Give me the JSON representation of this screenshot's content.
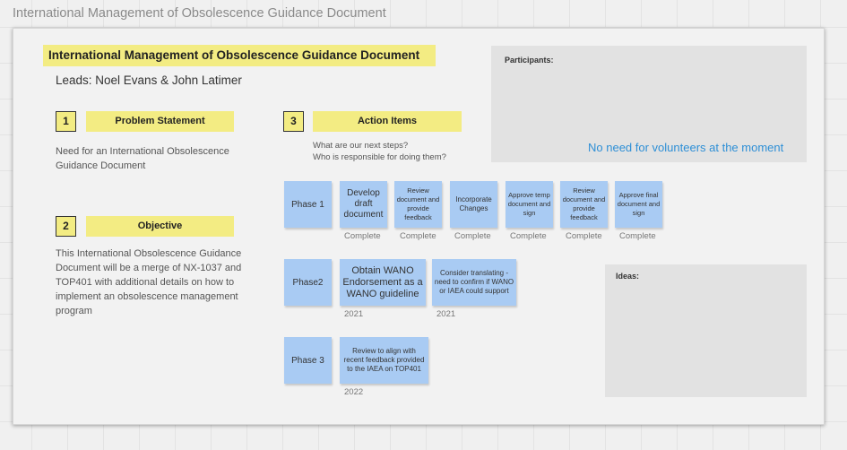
{
  "page": {
    "heading": "International Management of Obsolescence Guidance Document"
  },
  "doc": {
    "title": "International Management of Obsolescence Guidance Document",
    "leads": "Leads: Noel Evans & John Latimer"
  },
  "sections": {
    "problem": {
      "number": "1",
      "label": "Problem Statement",
      "text": "Need for an International Obsolescence Guidance Document"
    },
    "objective": {
      "number": "2",
      "label": "Objective",
      "text": "This International Obsolescence Guidance Document will be a merge of NX-1037 and TOP401 with additional details on how to implement an obsolescence management program"
    },
    "actions": {
      "number": "3",
      "label": "Action Items",
      "prompt_line1": "What are our next steps?",
      "prompt_line2": "Who is responsible for doing them?"
    }
  },
  "participants": {
    "title": "Participants:",
    "note": "No need for volunteers at the moment"
  },
  "ideas": {
    "title": "Ideas:"
  },
  "phase1": {
    "label": "Phase 1",
    "items": [
      {
        "text": "Develop draft document",
        "status": "Complete"
      },
      {
        "text": "Review document and provide feedback",
        "status": "Complete"
      },
      {
        "text": "Incorporate Changes",
        "status": "Complete"
      },
      {
        "text": "Approve temp document and sign",
        "status": "Complete"
      },
      {
        "text": "Review document and provide feedback",
        "status": "Complete"
      },
      {
        "text": "Approve final document and sign",
        "status": "Complete"
      }
    ]
  },
  "phase2": {
    "label": "Phase2",
    "items": [
      {
        "text": "Obtain WANO Endorsement as a WANO guideline",
        "status": "2021"
      },
      {
        "text": "Consider translating - need to confirm if WANO or IAEA could support",
        "status": "2021"
      }
    ]
  },
  "phase3": {
    "label": "Phase 3",
    "items": [
      {
        "text": "Review to align with recent feedback provided to the IAEA on TOP401",
        "status": "2022"
      }
    ]
  }
}
